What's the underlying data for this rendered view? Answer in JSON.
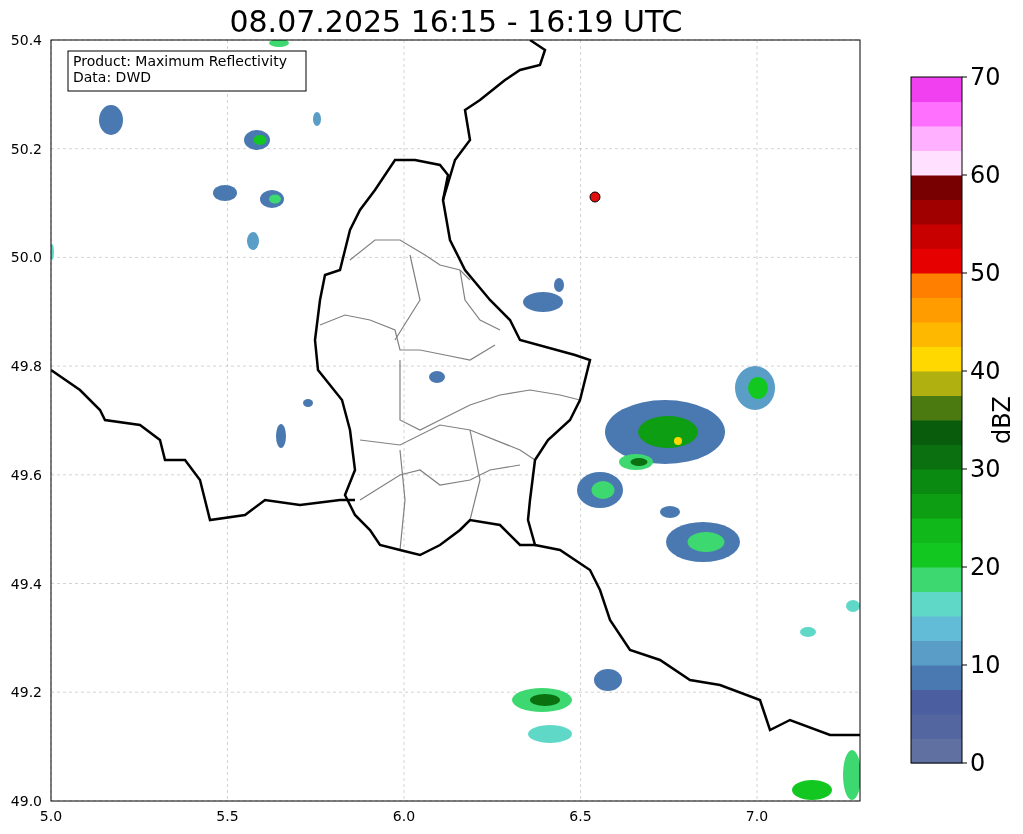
{
  "title": "08.07.2025 16:15 - 16:19 UTC",
  "info_box": {
    "lines": [
      "Product: Maximum Reflectivity",
      "Data: DWD"
    ]
  },
  "map": {
    "xticks": [
      "5.0",
      "5.5",
      "6.0",
      "6.5",
      "7.0"
    ],
    "yticks": [
      "50.4",
      "50.2",
      "50.0",
      "49.8",
      "49.6",
      "49.4",
      "49.2",
      "49.0"
    ]
  },
  "colorbar": {
    "label": "dBZ",
    "ticks": [
      "70",
      "60",
      "50",
      "40",
      "30",
      "20",
      "10",
      "0"
    ]
  }
}
